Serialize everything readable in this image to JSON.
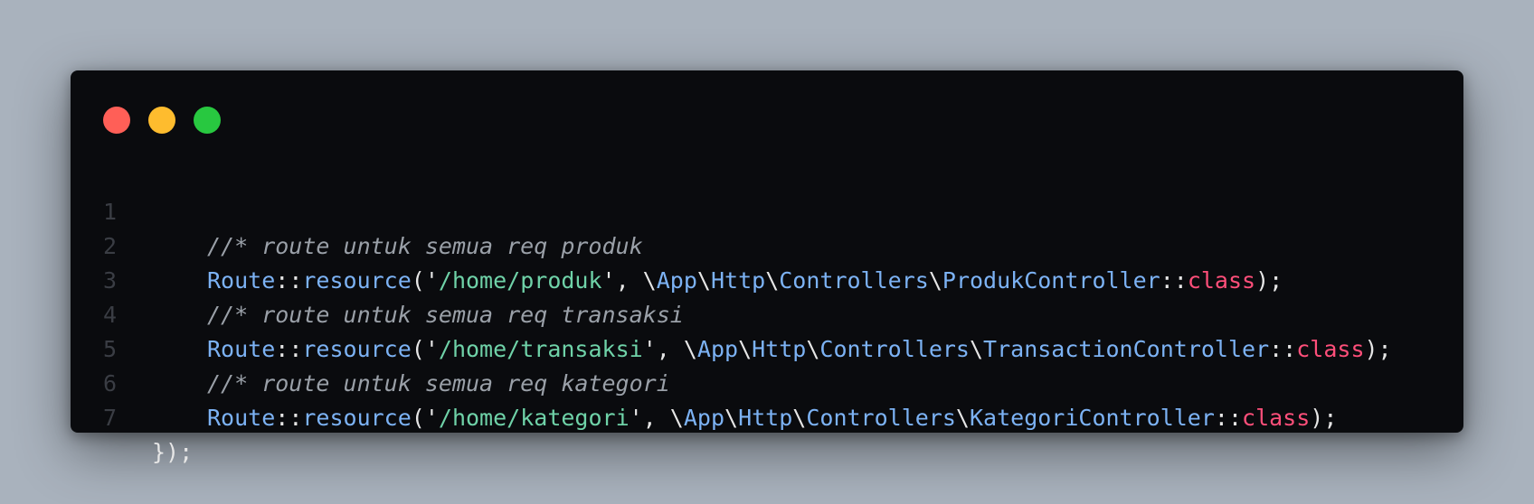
{
  "window": {
    "buttons": {
      "close_color": "#ff5f57",
      "minimize_color": "#febc2e",
      "maximize_color": "#28c840"
    }
  },
  "code": {
    "language": "php",
    "lines": [
      {
        "number": "1",
        "comment": "//* route untuk semua req produk"
      },
      {
        "number": "2",
        "route": "Route",
        "sep1": "::",
        "method": "resource",
        "open": "('",
        "path": "/home/produk",
        "mid": "', \\",
        "ns1": "App",
        "bs1": "\\",
        "ns2": "Http",
        "bs2": "\\",
        "ns3": "Controllers",
        "bs3": "\\",
        "controller": "ProdukController",
        "sep2": "::",
        "keyword": "class",
        "close": ");"
      },
      {
        "number": "3",
        "comment": "//* route untuk semua req transaksi"
      },
      {
        "number": "4",
        "route": "Route",
        "sep1": "::",
        "method": "resource",
        "open": "('",
        "path": "/home/transaksi",
        "mid": "', \\",
        "ns1": "App",
        "bs1": "\\",
        "ns2": "Http",
        "bs2": "\\",
        "ns3": "Controllers",
        "bs3": "\\",
        "controller": "TransactionController",
        "sep2": "::",
        "keyword": "class",
        "close": ");"
      },
      {
        "number": "5",
        "comment": "//* route untuk semua req kategori"
      },
      {
        "number": "6",
        "route": "Route",
        "sep1": "::",
        "method": "resource",
        "open": "('",
        "path": "/home/kategori",
        "mid": "', \\",
        "ns1": "App",
        "bs1": "\\",
        "ns2": "Http",
        "bs2": "\\",
        "ns3": "Controllers",
        "bs3": "\\",
        "controller": "KategoriController",
        "sep2": "::",
        "keyword": "class",
        "close": ");"
      },
      {
        "number": "7",
        "text": "});"
      }
    ]
  }
}
